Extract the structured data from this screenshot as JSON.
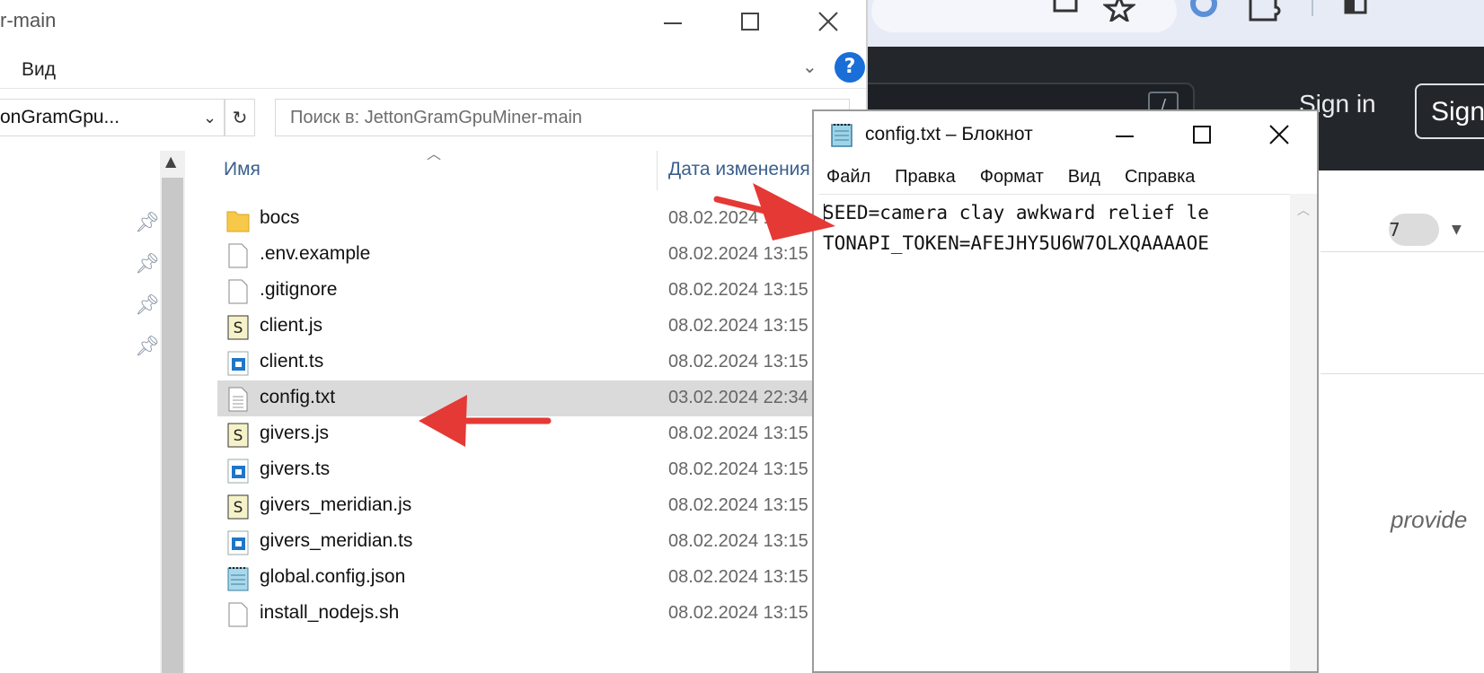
{
  "explorer": {
    "title_partial": "r-main",
    "menu_view": "Вид",
    "address_partial": "onGramGpu...",
    "search_placeholder": "Поиск в: JettonGramGpuMiner-main",
    "columns": {
      "name": "Имя",
      "date": "Дата изменения"
    },
    "files": [
      {
        "name": "bocs",
        "date": "08.02.2024 13:15",
        "icon": "folder-icon"
      },
      {
        "name": ".env.example",
        "date": "08.02.2024 13:15",
        "icon": "file-icon"
      },
      {
        "name": ".gitignore",
        "date": "08.02.2024 13:15",
        "icon": "file-icon"
      },
      {
        "name": "client.js",
        "date": "08.02.2024 13:15",
        "icon": "js-file-icon"
      },
      {
        "name": "client.ts",
        "date": "08.02.2024 13:15",
        "icon": "ts-file-icon"
      },
      {
        "name": "config.txt",
        "date": "03.02.2024 22:34",
        "icon": "text-file-icon",
        "selected": true
      },
      {
        "name": "givers.js",
        "date": "08.02.2024 13:15",
        "icon": "js-file-icon"
      },
      {
        "name": "givers.ts",
        "date": "08.02.2024 13:15",
        "icon": "ts-file-icon"
      },
      {
        "name": "givers_meridian.js",
        "date": "08.02.2024 13:15",
        "icon": "js-file-icon"
      },
      {
        "name": "givers_meridian.ts",
        "date": "08.02.2024 13:15",
        "icon": "ts-file-icon"
      },
      {
        "name": "global.config.json",
        "date": "08.02.2024 13:15",
        "icon": "json-file-icon"
      },
      {
        "name": "install_nodejs.sh",
        "date": "08.02.2024 13:15",
        "icon": "file-icon"
      }
    ]
  },
  "notepad": {
    "title": "config.txt – Блокнот",
    "menu": [
      "Файл",
      "Правка",
      "Формат",
      "Вид",
      "Справка"
    ],
    "lines": [
      "SEED=camera clay awkward relief le",
      "TONAPI_TOKEN=AFEJHY5U6W7OLXQAAAAOE"
    ]
  },
  "browser": {
    "sign_in": "Sign in",
    "sign_up_partial": "Sign",
    "counter_partial": "7",
    "partial_text": "provide"
  },
  "annotations": {
    "arrow_color": "#e53935"
  }
}
